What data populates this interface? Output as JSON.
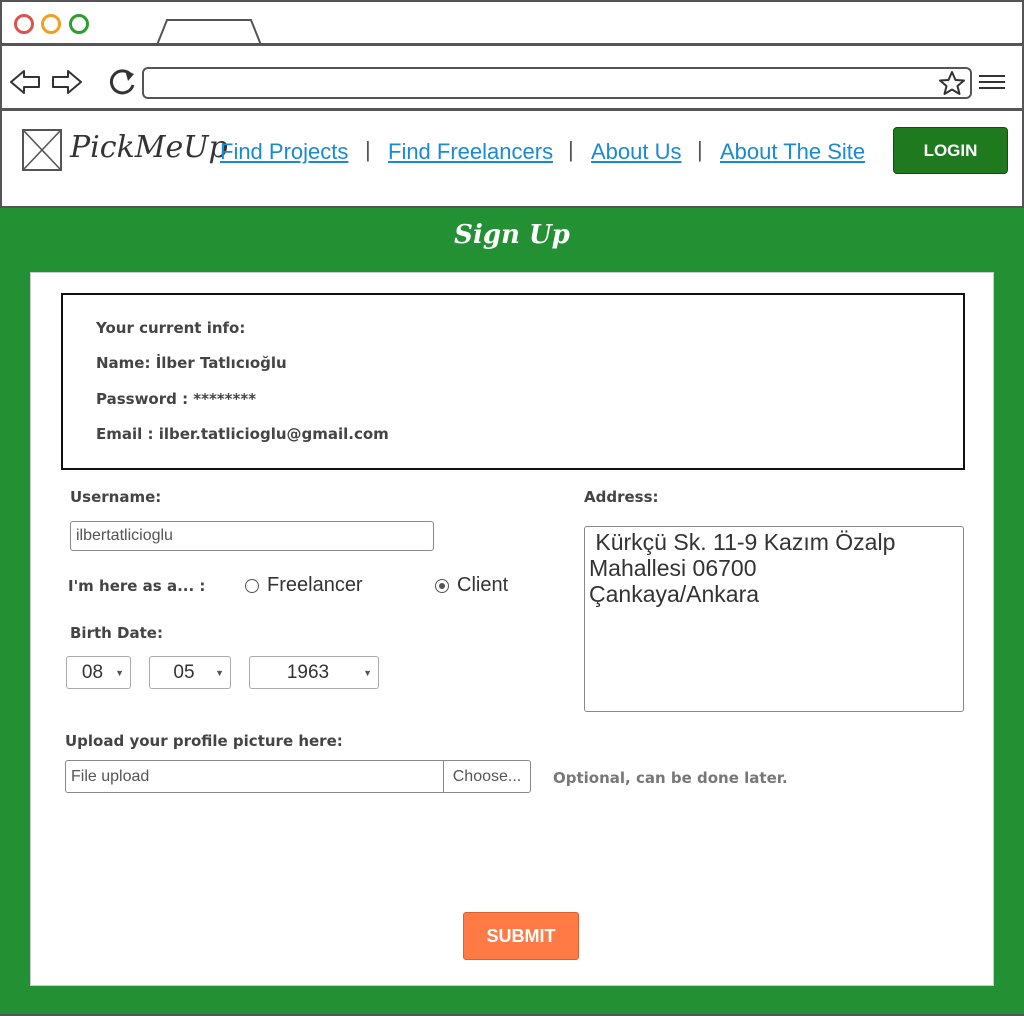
{
  "browser": {
    "dot_colors": [
      "#d9534f",
      "#f0a020",
      "#2e9e2e"
    ],
    "address": ""
  },
  "header": {
    "brand": "PickMeUp",
    "nav": [
      "Find Projects",
      "Find Freelancers",
      "About Us",
      "About The Site"
    ],
    "separator": "|",
    "login_label": "LOGIN"
  },
  "page": {
    "title": "Sign Up"
  },
  "current_info": {
    "heading": "Your current info:",
    "name": "Name: İlber Tatlıcıoğlu",
    "password": "Password : ********",
    "email": "Email : ilber.tatlicioglu@gmail.com"
  },
  "form": {
    "username_label": "Username:",
    "username_value": "ilbertatlicioglu",
    "role_label": "I'm here as a... :",
    "role_options": [
      "Freelancer",
      "Client"
    ],
    "role_selected": "Client",
    "birth_label": "Birth Date:",
    "birth_day": "08",
    "birth_month": "05",
    "birth_year": "1963",
    "address_label": "Address:",
    "address_value": " Kürkçü Sk. 11-9 Kazım Özalp\nMahallesi 06700\nÇankaya/Ankara",
    "upload_label": "Upload your profile picture here:",
    "upload_placeholder": "File upload",
    "upload_button": "Choose...",
    "upload_note": "Optional, can be done later.",
    "submit_label": "SUBMIT"
  },
  "colors": {
    "green": "#239133",
    "login": "#1f7a1f",
    "link": "#1a8ad4",
    "submit": "#ff7a45"
  },
  "icons": [
    "back-arrow-icon",
    "forward-arrow-icon",
    "reload-icon",
    "star-icon",
    "hamburger-menu-icon",
    "image-placeholder-icon"
  ]
}
